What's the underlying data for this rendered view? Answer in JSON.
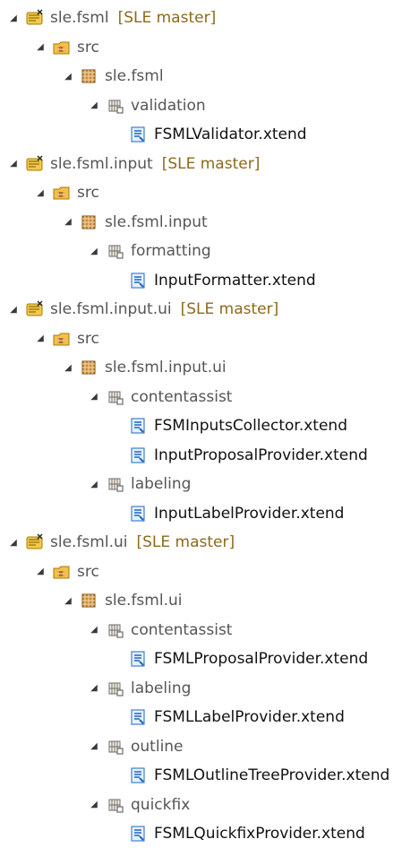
{
  "tree": {
    "colors": {
      "branch": "#8b6a1a",
      "package": "#b0722a",
      "file": "#1f67c2"
    },
    "icons": {
      "project": "project-repo-icon",
      "src": "source-folder-icon",
      "package": "package-icon",
      "subpackage": "subpackage-icon",
      "file": "xtend-file-icon",
      "toggle": "triangle-expanded-icon"
    },
    "rows": [
      {
        "label": "sle.fsml",
        "branch": "[SLE master]",
        "type": "project",
        "level": 0
      },
      {
        "label": "src",
        "type": "src",
        "level": 1
      },
      {
        "label": "sle.fsml",
        "type": "package",
        "level": 2
      },
      {
        "label": "validation",
        "type": "subpackage",
        "level": 3
      },
      {
        "label": "FSMLValidator.xtend",
        "type": "file",
        "level": 4
      },
      {
        "label": "sle.fsml.input",
        "branch": "[SLE master]",
        "type": "project",
        "level": 0
      },
      {
        "label": "src",
        "type": "src",
        "level": 1
      },
      {
        "label": "sle.fsml.input",
        "type": "package",
        "level": 2
      },
      {
        "label": "formatting",
        "type": "subpackage",
        "level": 3
      },
      {
        "label": "InputFormatter.xtend",
        "type": "file",
        "level": 4
      },
      {
        "label": "sle.fsml.input.ui",
        "branch": "[SLE master]",
        "type": "project",
        "level": 0
      },
      {
        "label": "src",
        "type": "src",
        "level": 1
      },
      {
        "label": "sle.fsml.input.ui",
        "type": "package",
        "level": 2
      },
      {
        "label": "contentassist",
        "type": "subpackage",
        "level": 3
      },
      {
        "label": "FSMInputsCollector.xtend",
        "type": "file",
        "level": 4
      },
      {
        "label": "InputProposalProvider.xtend",
        "type": "file",
        "level": 4
      },
      {
        "label": "labeling",
        "type": "subpackage",
        "level": 3
      },
      {
        "label": "InputLabelProvider.xtend",
        "type": "file",
        "level": 4
      },
      {
        "label": "sle.fsml.ui",
        "branch": "[SLE master]",
        "type": "project",
        "level": 0
      },
      {
        "label": "src",
        "type": "src",
        "level": 1
      },
      {
        "label": "sle.fsml.ui",
        "type": "package",
        "level": 2
      },
      {
        "label": "contentassist",
        "type": "subpackage",
        "level": 3
      },
      {
        "label": "FSMLProposalProvider.xtend",
        "type": "file",
        "level": 4
      },
      {
        "label": "labeling",
        "type": "subpackage",
        "level": 3
      },
      {
        "label": "FSMLLabelProvider.xtend",
        "type": "file",
        "level": 4
      },
      {
        "label": "outline",
        "type": "subpackage",
        "level": 3
      },
      {
        "label": "FSMLOutlineTreeProvider.xtend",
        "type": "file",
        "level": 4
      },
      {
        "label": "quickfix",
        "type": "subpackage",
        "level": 3
      },
      {
        "label": "FSMLQuickfixProvider.xtend",
        "type": "file",
        "level": 4
      }
    ]
  }
}
